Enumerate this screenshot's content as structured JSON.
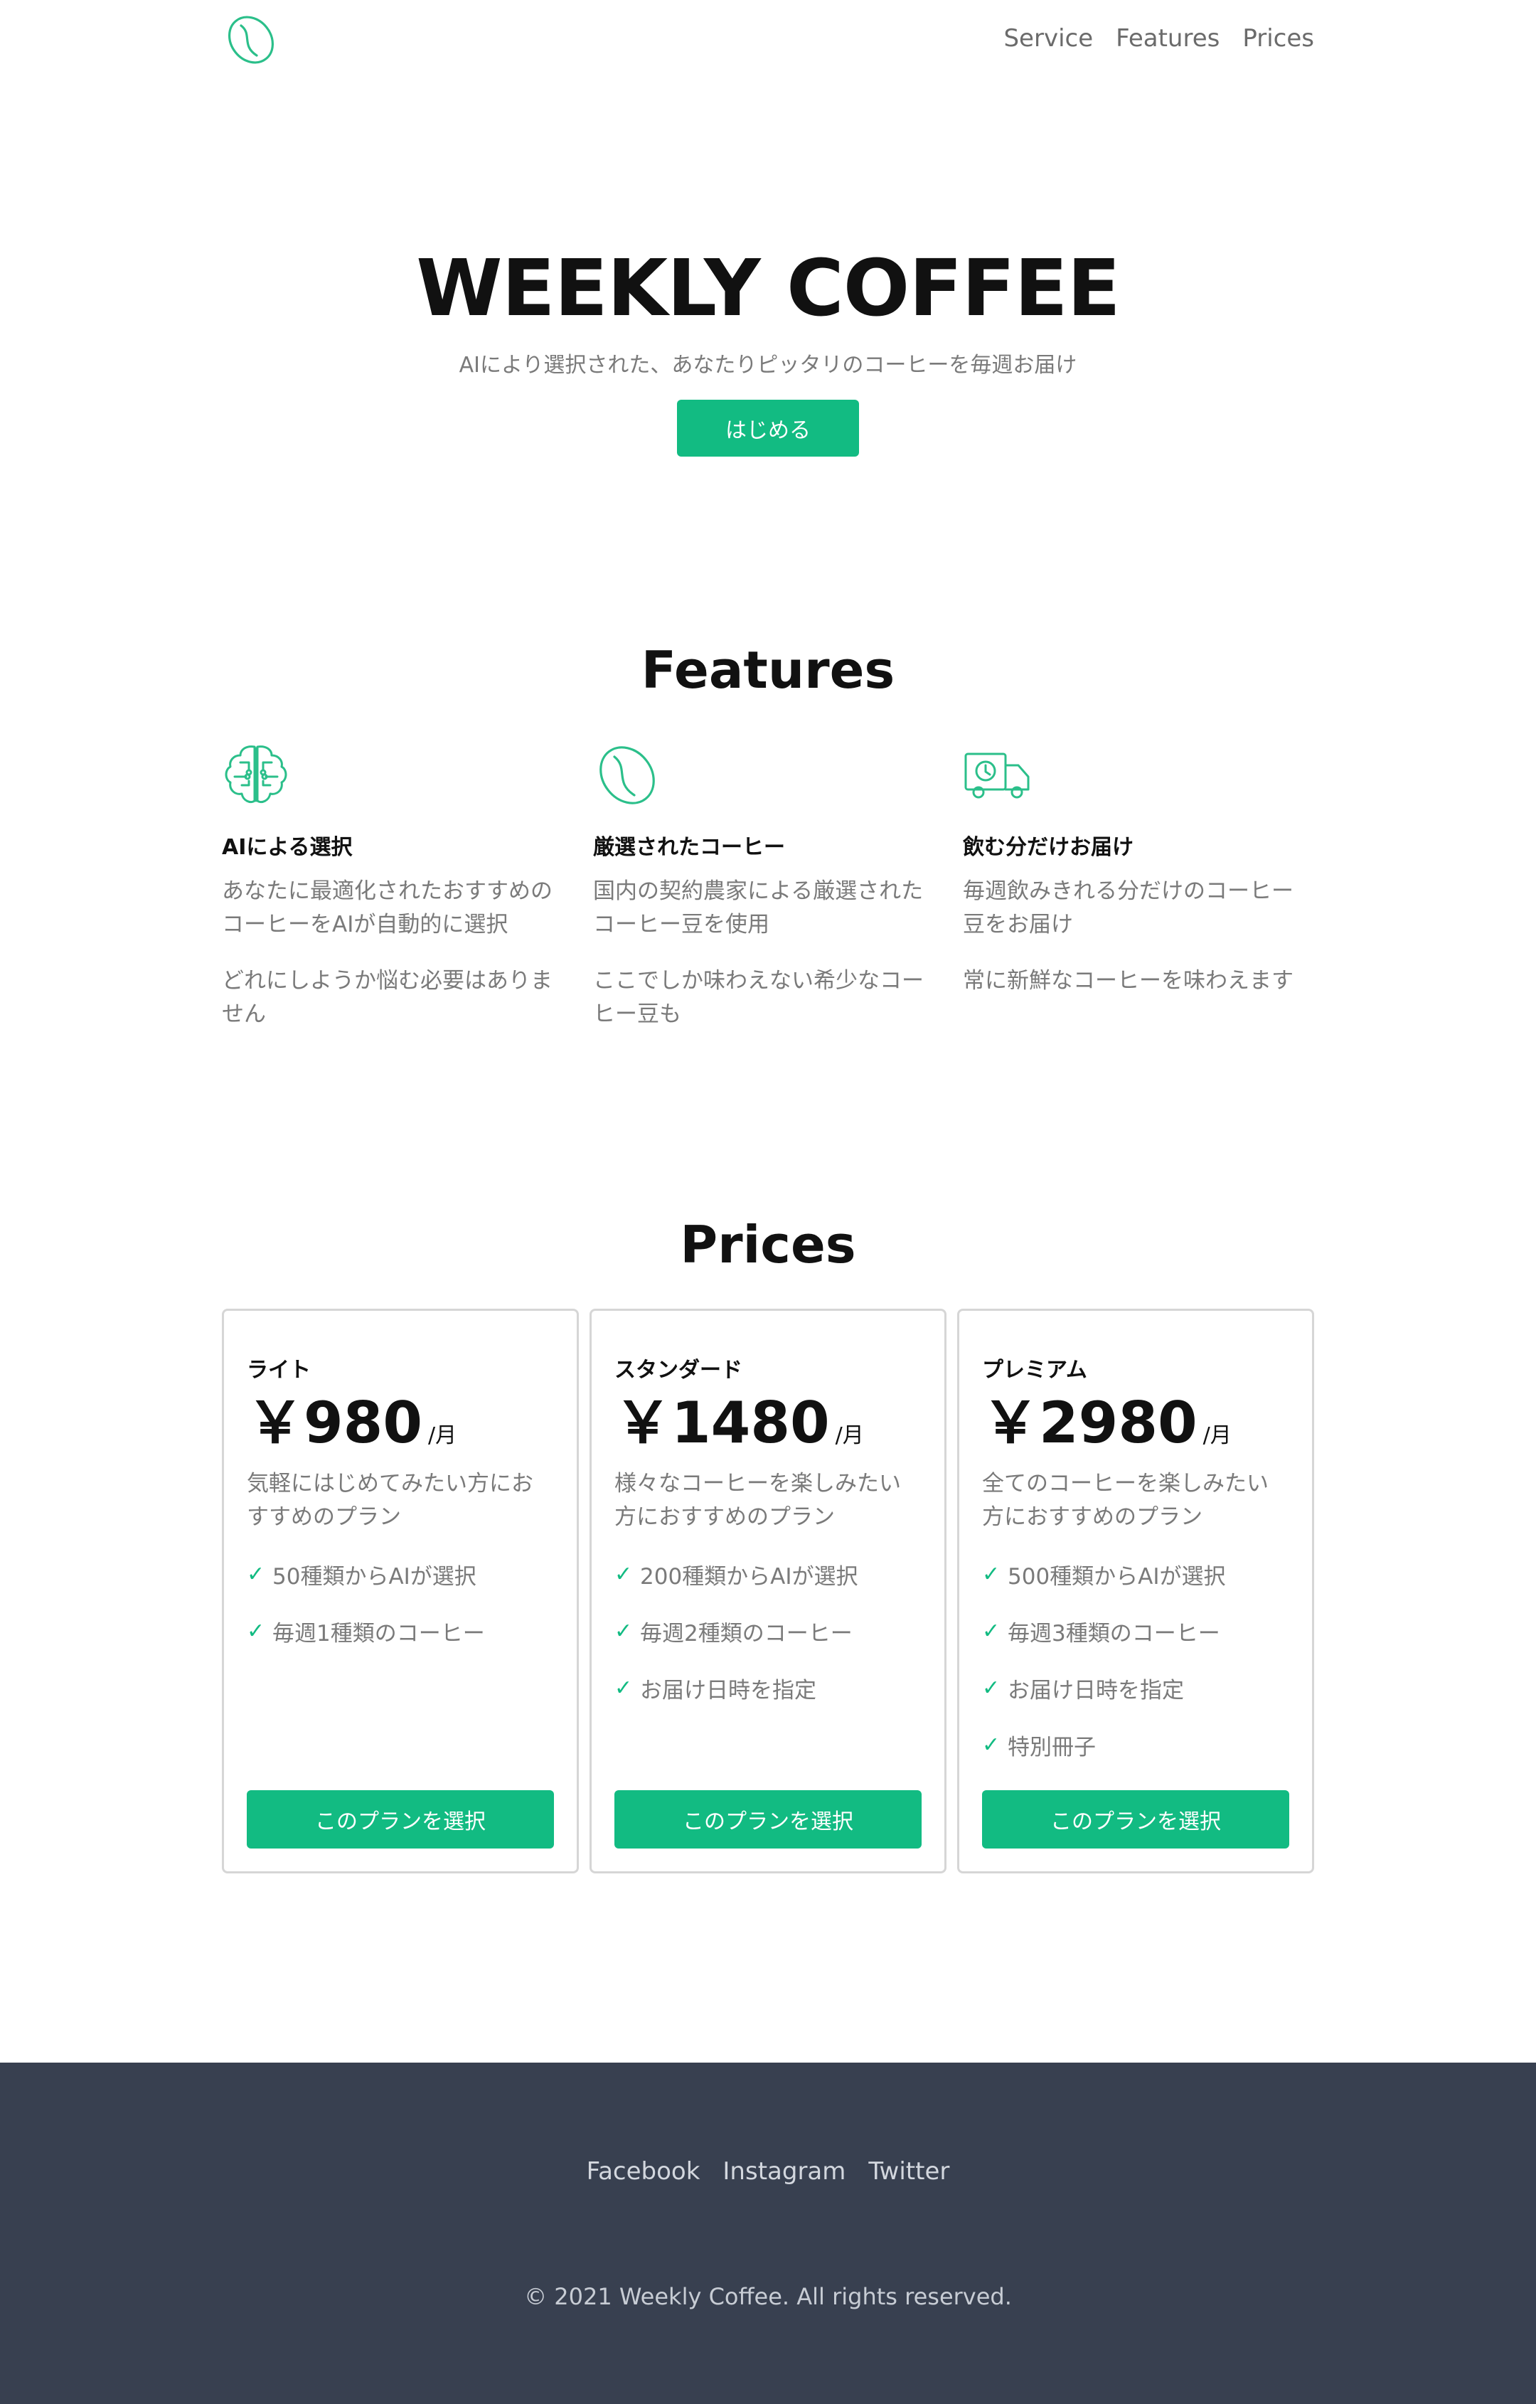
{
  "nav": {
    "logo_icon": "coffee-bean-icon",
    "links": [
      "Service",
      "Features",
      "Prices"
    ]
  },
  "hero": {
    "title": "WEEKLY COFFEE",
    "subtitle": "AIにより選択された、あなたりピッタリのコーヒーを毎週お届け",
    "cta": "はじめる"
  },
  "features": {
    "heading": "Features",
    "items": [
      {
        "icon": "brain-circuit-icon",
        "title": "AIによる選択",
        "text1": "あなたに最適化されたおすすめのコーヒーをAIが自動的に選択",
        "text2": "どれにしようか悩む必要はありません"
      },
      {
        "icon": "coffee-bean-icon",
        "title": "厳選されたコーヒー",
        "text1": "国内の契約農家による厳選されたコーヒー豆を使用",
        "text2": "ここでしか味わえない希少なコーヒー豆も"
      },
      {
        "icon": "delivery-truck-icon",
        "title": "飲む分だけお届け",
        "text1": "毎週飲みきれる分だけのコーヒー豆をお届け",
        "text2": "常に新鮮なコーヒーを味わえます"
      }
    ]
  },
  "prices": {
    "heading": "Prices",
    "plans": [
      {
        "name": "ライト",
        "price": "￥980",
        "unit": "/月",
        "desc": "気軽にはじめてみたい方におすすめのプラン",
        "features": [
          "50種類からAIが選択",
          "毎週1種類のコーヒー"
        ],
        "button": "このプランを選択"
      },
      {
        "name": "スタンダード",
        "price": "￥1480",
        "unit": "/月",
        "desc": "様々なコーヒーを楽しみたい方におすすめのプラン",
        "features": [
          "200種類からAIが選択",
          "毎週2種類のコーヒー",
          "お届け日時を指定"
        ],
        "button": "このプランを選択"
      },
      {
        "name": "プレミアム",
        "price": "￥2980",
        "unit": "/月",
        "desc": "全てのコーヒーを楽しみたい方におすすめのプラン",
        "features": [
          "500種類からAIが選択",
          "毎週3種類のコーヒー",
          "お届け日時を指定",
          "特別冊子"
        ],
        "button": "このプランを選択"
      }
    ],
    "check_icon": "check-icon"
  },
  "footer": {
    "links": [
      "Facebook",
      "Instagram",
      "Twitter"
    ],
    "copyright": "© 2021 Weekly Coffee. All rights reserved."
  },
  "colors": {
    "accent": "#12bb82",
    "footer_bg": "#384050",
    "muted_text": "#7a7a7a"
  }
}
